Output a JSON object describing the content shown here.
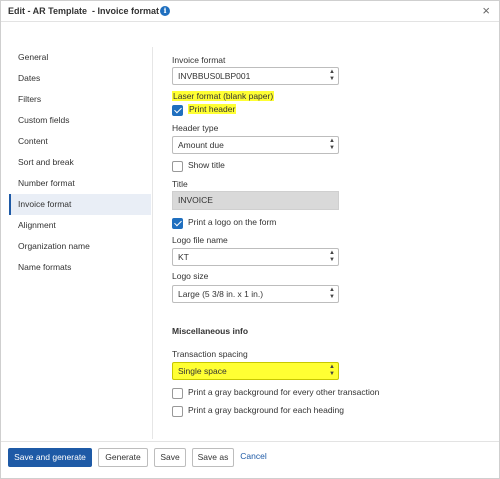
{
  "dialog": {
    "title": "Edit - AR Template  - Invoice format",
    "info_icon": "i",
    "close_icon": "×"
  },
  "sidebar": {
    "items": [
      {
        "label": "General"
      },
      {
        "label": "Dates"
      },
      {
        "label": "Filters"
      },
      {
        "label": "Custom fields"
      },
      {
        "label": "Content"
      },
      {
        "label": "Sort and break"
      },
      {
        "label": "Number format"
      },
      {
        "label": "Invoice format",
        "active": true
      },
      {
        "label": "Alignment"
      },
      {
        "label": "Organization name"
      },
      {
        "label": "Name formats"
      }
    ]
  },
  "form": {
    "invoice_format_label": "Invoice format",
    "invoice_format_value": "INVBBUS0LBP001",
    "laser_format_label": "Laser format (blank paper)",
    "print_header_label": "Print header",
    "print_header_checked": true,
    "header_type_label": "Header type",
    "header_type_value": "Amount due",
    "show_title_label": "Show title",
    "show_title_checked": false,
    "title_label": "Title",
    "title_value": "INVOICE",
    "print_logo_label": "Print a logo on the form",
    "print_logo_checked": true,
    "logo_file_label": "Logo file name",
    "logo_file_value": "KT",
    "logo_size_label": "Logo size",
    "logo_size_value": "Large (5 3/8 in. x 1 in.)",
    "misc_heading": "Miscellaneous info",
    "transaction_spacing_label": "Transaction spacing",
    "transaction_spacing_value": "Single space",
    "gray_every_other_label": "Print a gray background for every other transaction",
    "gray_every_other_checked": false,
    "gray_heading_label": "Print a gray background for each heading",
    "gray_heading_checked": false
  },
  "footer": {
    "save_generate": "Save and generate",
    "generate": "Generate",
    "save": "Save",
    "save_as": "Save as",
    "cancel": "Cancel"
  },
  "colors": {
    "accent": "#1e5aa6",
    "highlight": "#ffff33",
    "title_field_bg": "#d9d9d9"
  }
}
